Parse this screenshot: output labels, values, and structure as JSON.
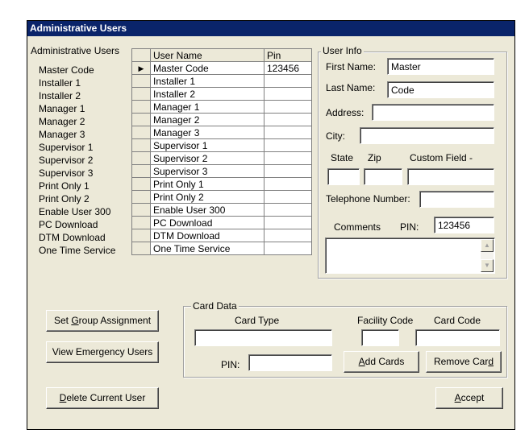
{
  "window": {
    "title": "Administrative Users"
  },
  "users": {
    "label": "Administrative Users",
    "list": [
      "Master Code",
      "Installer 1",
      "Installer 2",
      "Manager 1",
      "Manager 2",
      "Manager 3",
      "Supervisor 1",
      "Supervisor 2",
      "Supervisor 3",
      "Print Only 1",
      "Print Only 2",
      "Enable User 300",
      "PC Download",
      "DTM Download",
      "One Time Service"
    ]
  },
  "grid": {
    "headers": {
      "user_name": "User Name",
      "pin": "Pin"
    },
    "current_row_marker": "▶",
    "rows": [
      {
        "name": "Master Code",
        "pin": "123456"
      },
      {
        "name": "Installer 1",
        "pin": ""
      },
      {
        "name": "Installer 2",
        "pin": ""
      },
      {
        "name": "Manager 1",
        "pin": ""
      },
      {
        "name": "Manager 2",
        "pin": ""
      },
      {
        "name": "Manager 3",
        "pin": ""
      },
      {
        "name": "Supervisor 1",
        "pin": ""
      },
      {
        "name": "Supervisor 2",
        "pin": ""
      },
      {
        "name": "Supervisor 3",
        "pin": ""
      },
      {
        "name": "Print Only 1",
        "pin": ""
      },
      {
        "name": "Print Only 2",
        "pin": ""
      },
      {
        "name": "Enable User 300",
        "pin": ""
      },
      {
        "name": "PC Download",
        "pin": ""
      },
      {
        "name": "DTM Download",
        "pin": ""
      },
      {
        "name": "One Time Service",
        "pin": ""
      }
    ]
  },
  "user_info": {
    "title": "User Info",
    "first_name_label": "First Name:",
    "first_name": "Master",
    "last_name_label": "Last Name:",
    "last_name": "Code",
    "address_label": "Address:",
    "address": "",
    "city_label": "City:",
    "city": "",
    "state_label": "State",
    "zip_label": "Zip",
    "custom_field_label": "Custom Field -",
    "state": "",
    "zip": "",
    "custom_field": "",
    "telephone_label": "Telephone Number:",
    "telephone": "",
    "comments_label": "Comments",
    "pin_label": "PIN:",
    "pin": "123456",
    "comments": ""
  },
  "buttons": {
    "set_group_pre": "Set ",
    "set_group_key": "G",
    "set_group_post": "roup Assignment",
    "view_emergency": "View Emergency Users",
    "delete_key": "D",
    "delete_post": "elete Current User",
    "accept_key": "A",
    "accept_post": "ccept"
  },
  "card_data": {
    "title": "Card Data",
    "card_type_label": "Card Type",
    "facility_code_label": "Facility Code",
    "card_code_label": "Card Code",
    "card_type": "",
    "facility_code": "",
    "card_code": "",
    "pin_label": "PIN:",
    "pin": "",
    "add_key": "A",
    "add_post": "dd Cards",
    "remove_pre": "Remove Car",
    "remove_key": "d"
  }
}
